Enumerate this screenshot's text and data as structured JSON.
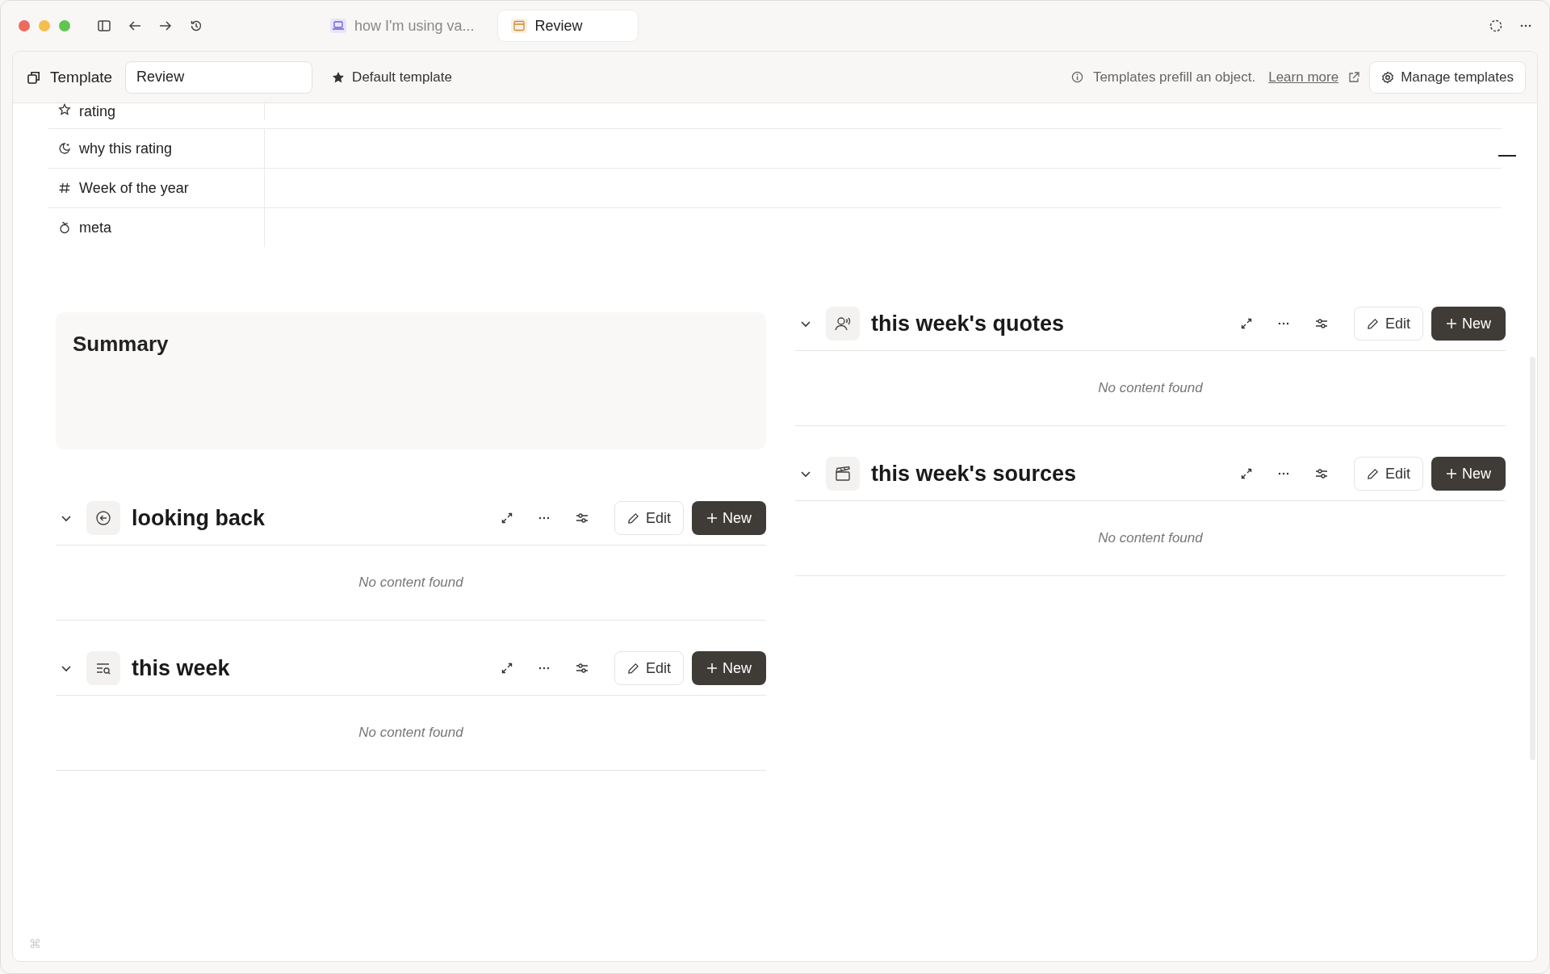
{
  "tabs": [
    {
      "label": "how I'm using va...",
      "selected": false
    },
    {
      "label": "Review",
      "selected": true
    }
  ],
  "toolbar": {
    "title": "Template",
    "name_value": "Review",
    "default_label": "Default template",
    "info": "Templates prefill an object.",
    "link": "Learn more",
    "manage": "Manage templates"
  },
  "properties": [
    {
      "name": "rating"
    },
    {
      "name": "why this rating"
    },
    {
      "name": "Week of the year"
    },
    {
      "name": "meta"
    }
  ],
  "summary": {
    "title": "Summary"
  },
  "left_sections": [
    {
      "title": "looking back",
      "expanded": true,
      "edit": "Edit",
      "new": "New",
      "message": "No content found"
    },
    {
      "title": "this week",
      "expanded": true,
      "edit": "Edit",
      "new": "New",
      "message": "No content found"
    }
  ],
  "right_sections": [
    {
      "title": "this week's quotes",
      "expanded": true,
      "edit": "Edit",
      "new": "New",
      "message": "No content found"
    },
    {
      "title": "this week's sources",
      "expanded": true,
      "edit": "Edit",
      "new": "New",
      "message": "No content found"
    }
  ],
  "shortcut_hint": "⌘"
}
